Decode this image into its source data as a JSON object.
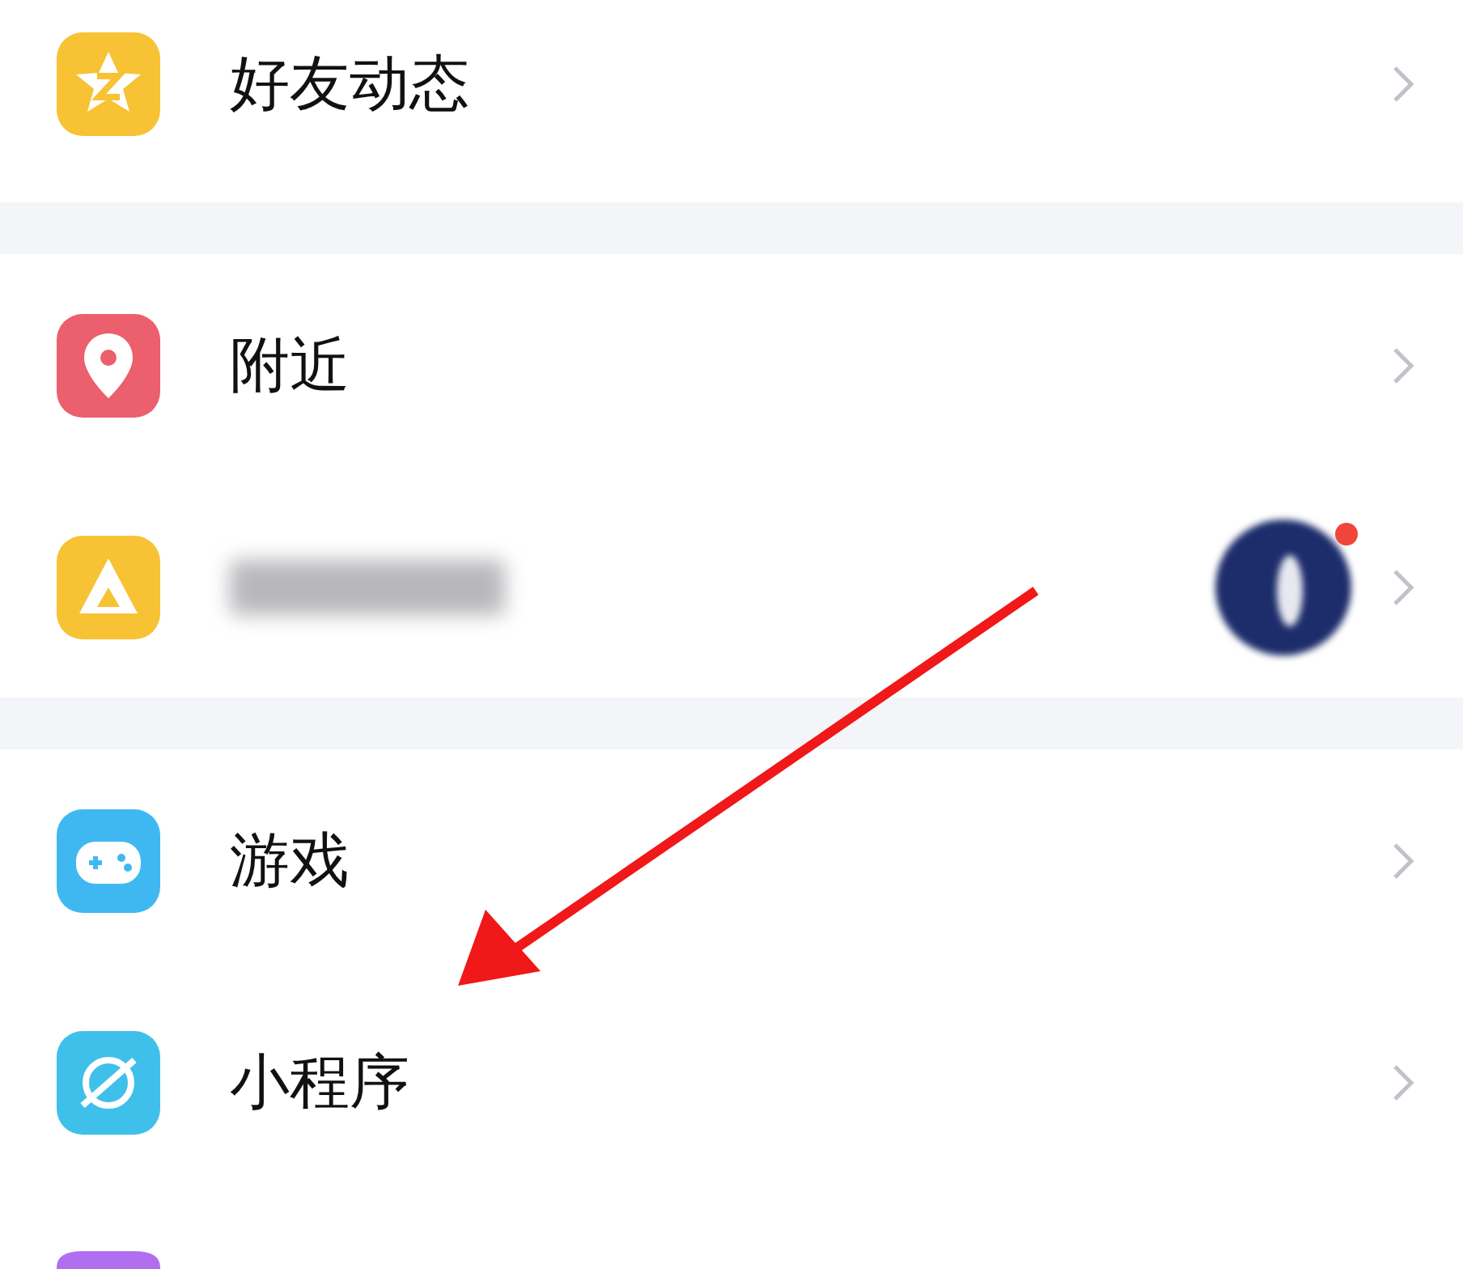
{
  "sections": [
    {
      "items": [
        {
          "kind": "item",
          "label": "好友动态"
        }
      ]
    },
    {
      "items": [
        {
          "kind": "item",
          "label": "附近"
        },
        {
          "kind": "blurred",
          "badge": true
        }
      ]
    },
    {
      "items": [
        {
          "kind": "item",
          "label": "游戏"
        },
        {
          "kind": "item",
          "label": "小程序"
        },
        {
          "kind": "partial"
        }
      ]
    }
  ]
}
